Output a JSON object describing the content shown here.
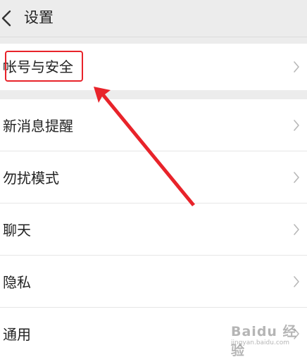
{
  "header": {
    "title": "设置",
    "back_icon": "chevron-left-icon"
  },
  "account_group": {
    "items": [
      {
        "label": "帐号与安全"
      }
    ]
  },
  "settings_group": {
    "items": [
      {
        "label": "新消息提醒"
      },
      {
        "label": "勿扰模式"
      },
      {
        "label": "聊天"
      },
      {
        "label": "隐私"
      },
      {
        "label": "通用"
      }
    ]
  },
  "annotation": {
    "highlight_color": "#e8232a",
    "arrow_color": "#e8232a"
  },
  "watermark": {
    "text": "Baidu 经验",
    "sub": "jingyan.baidu.com"
  },
  "colors": {
    "background": "#ececec",
    "row_background": "#ffffff",
    "text": "#222222",
    "chevron": "#b8b8b8"
  }
}
